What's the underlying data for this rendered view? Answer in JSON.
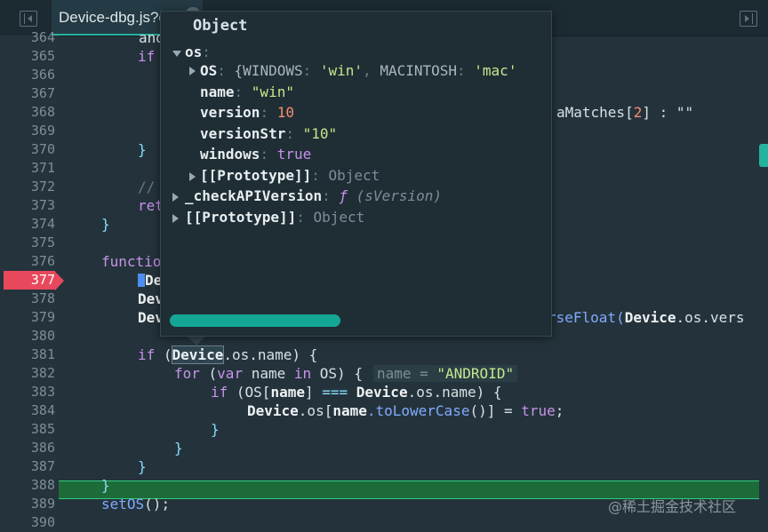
{
  "tab": {
    "title": "Device-dbg.js?c"
  },
  "icons": {
    "left_panel": "panel-collapse-left-icon",
    "right_panel": "panel-collapse-right-icon",
    "tab_close": "close-icon"
  },
  "gutter": {
    "lines": [
      "364",
      "365",
      "366",
      "367",
      "368",
      "369",
      "370",
      "371",
      "372",
      "373",
      "374",
      "375",
      "376",
      "377",
      "378",
      "379",
      "380",
      "381",
      "382",
      "383",
      "384",
      "385",
      "386",
      "387",
      "388",
      "389",
      "390"
    ],
    "breakpoint_line": "377",
    "current_line": "388"
  },
  "code": {
    "l364": "and",
    "l365_kw": "if",
    "l368_tail1": "aMatches[",
    "l368_num": "2",
    "l368_tail2": "] : \"\"",
    "l370": "}",
    "l372_cm": "//",
    "l373_kw": "ret",
    "l374": "}",
    "l376_kw": "functio",
    "l377": "De",
    "l378": "Devi",
    "l379_head": "Dev",
    "l379_fn": "rseFloat(",
    "l379_obj": "Device",
    "l379_tail": ".os.vers",
    "l381_kw": "if",
    "l381_open": " (",
    "l381_obj": "Device",
    "l381_rest": ".os.name) {",
    "l382_kw1": "for",
    "l382_p1": " (",
    "l382_kw2": "var",
    "l382_name": " name ",
    "l382_kw3": "in",
    "l382_os": " OS",
    "l382_close": ") {",
    "l382_inline_key": "name",
    "l382_inline_eq": " = ",
    "l382_inline_val": "\"ANDROID\"",
    "l383_kw": "if",
    "l383_a": " (OS[",
    "l383_b": "name",
    "l383_c": "] ",
    "l383_op": "===",
    "l383_d": " Device",
    "l383_e": ".os.name) {",
    "l384_a": "Device",
    "l384_b": ".os[",
    "l384_c": "name",
    "l384_d": ".toLowerCase",
    "l384_e": "()] = ",
    "l384_f": "true",
    "l384_g": ";",
    "l385": "}",
    "l386": "}",
    "l387": "}",
    "l388": "}",
    "l389_fn": "setOS",
    "l389_tail": "();"
  },
  "popup": {
    "title": "Object",
    "os_key": "os",
    "os_sep": ":",
    "OS_key": "OS",
    "OS_sep": ": ",
    "OS_preview_open": "{",
    "OS_preview_k1": "WINDOWS",
    "OS_preview_c1": ": ",
    "OS_preview_v1": "'win'",
    "OS_preview_comma": ", ",
    "OS_preview_k2": "MACINTOSH",
    "OS_preview_c2": ": ",
    "OS_preview_v2": "'mac'",
    "name_key": "name",
    "name_sep": ": ",
    "name_val": "\"win\"",
    "version_key": "version",
    "version_sep": ": ",
    "version_val": "10",
    "versionStr_key": "versionStr",
    "versionStr_sep": ": ",
    "versionStr_val": "\"10\"",
    "windows_key": "windows",
    "windows_sep": ": ",
    "windows_val": "true",
    "proto_key": "[[Prototype]]",
    "proto_sep": ": ",
    "proto_val": "Object",
    "check_key": "_checkAPIVersion",
    "check_sep": ": ",
    "check_f": "ƒ",
    "check_sig": " (sVersion)",
    "proto2_key": "[[Prototype]]",
    "proto2_sep": ": ",
    "proto2_val": "Object"
  },
  "watermark": "@稀土掘金技术社区",
  "colors": {
    "accent": "#27b0a2",
    "breakpoint": "#e8485c",
    "current_line": "#1e6b3a"
  }
}
